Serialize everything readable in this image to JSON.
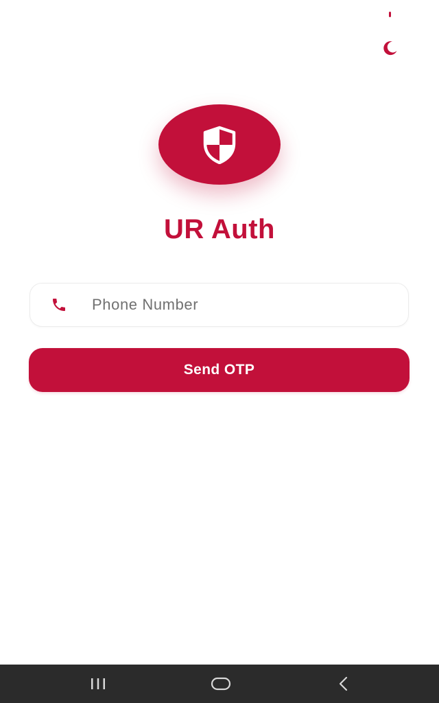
{
  "colors": {
    "accent": "#c2103a",
    "background": "#ffffff",
    "nav_bar": "#2b2b2b",
    "placeholder": "#707070"
  },
  "header": {
    "theme_toggle_icon": "crescent-moon-icon"
  },
  "logo": {
    "icon": "shield-icon"
  },
  "app": {
    "title": "UR Auth"
  },
  "phone_field": {
    "icon": "phone-icon",
    "value": "",
    "placeholder": "Phone Number"
  },
  "send_button": {
    "label": "Send OTP"
  },
  "nav_bar": {
    "items": [
      {
        "icon": "recent-apps-icon"
      },
      {
        "icon": "home-icon"
      },
      {
        "icon": "back-icon"
      }
    ]
  }
}
